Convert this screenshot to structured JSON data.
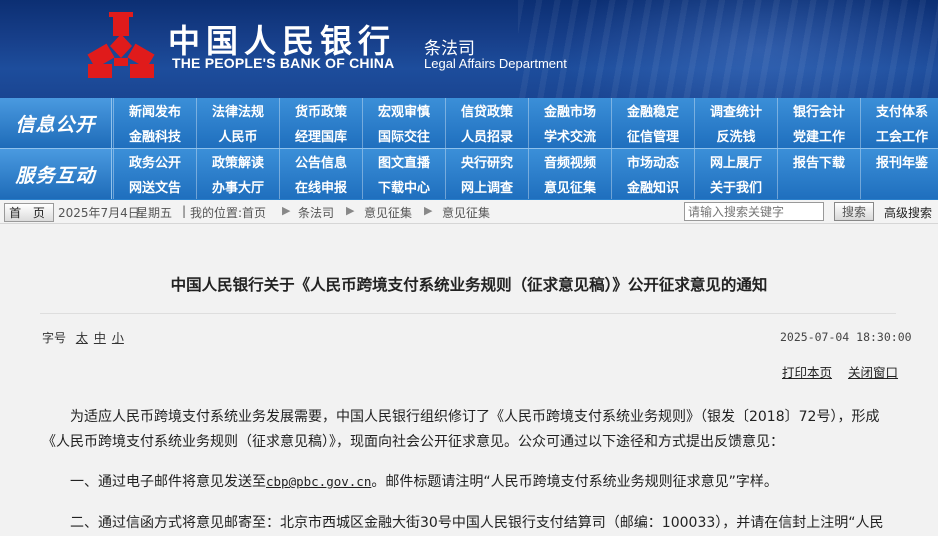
{
  "header": {
    "bank_name_cn": "中国人民银行",
    "bank_name_en": "THE PEOPLE'S BANK OF CHINA",
    "dept_cn": "条法司",
    "dept_en": "Legal Affairs Department",
    "logo_icon": "pboc-logo-icon",
    "colors": {
      "banner": "#173f8a",
      "logo": "#e01b1b"
    }
  },
  "nav": {
    "info": {
      "label": "信息公开",
      "items": [
        "新闻发布",
        "法律法规",
        "货币政策",
        "宏观审慎",
        "信贷政策",
        "金融市场",
        "金融稳定",
        "调查统计",
        "银行会计",
        "支付体系",
        "金融科技",
        "人民币",
        "经理国库",
        "国际交往",
        "人员招录",
        "学术交流",
        "征信管理",
        "反洗钱",
        "党建工作",
        "工会工作"
      ]
    },
    "service": {
      "label": "服务互动",
      "items": [
        "政务公开",
        "政策解读",
        "公告信息",
        "图文直播",
        "央行研究",
        "音频视频",
        "市场动态",
        "网上展厅",
        "报告下载",
        "报刊年鉴",
        "网送文告",
        "办事大厅",
        "在线申报",
        "下载中心",
        "网上调查",
        "意见征集",
        "金融知识",
        "关于我们",
        "",
        ""
      ]
    },
    "colors": {
      "bar": "#2a80cc"
    }
  },
  "breadcrumb": {
    "home_label": "首 页",
    "date_text": "2025年7月4日",
    "weekday": "星期五",
    "location_label": "我的位置:首页",
    "items": [
      "条法司",
      "意见征集",
      "意见征集"
    ],
    "search_placeholder": "请输入搜索关键字",
    "search_button": "搜索",
    "advanced_search": "高级搜索"
  },
  "article": {
    "title": "中国人民银行关于《人民币跨境支付系统业务规则（征求意见稿）》公开征求意见的通知",
    "font_size_label": "字号",
    "font_sizes": [
      "太",
      "中",
      "小"
    ],
    "datetime": "2025-07-04 18:30:00",
    "print_label": "打印本页",
    "close_label": "关闭窗口",
    "para1": "为适应人民币跨境支付系统业务发展需要，中国人民银行组织修订了《人民币跨境支付系统业务规则》（银发〔2018〕72号），形成《人民币跨境支付系统业务规则（征求意见稿）》，现面向社会公开征求意见。公众可通过以下途径和方式提出反馈意见：",
    "para2_prefix": "一、通过电子邮件将意见发送至",
    "email": "cbp@pbc.gov.cn",
    "para2_suffix": "。邮件标题请注明“人民币跨境支付系统业务规则征求意见”字样。",
    "para3": "二、通过信函方式将意见邮寄至：北京市西城区金融大街30号中国人民银行支付结算司（邮编：100033），并请在信封上注明“人民"
  }
}
